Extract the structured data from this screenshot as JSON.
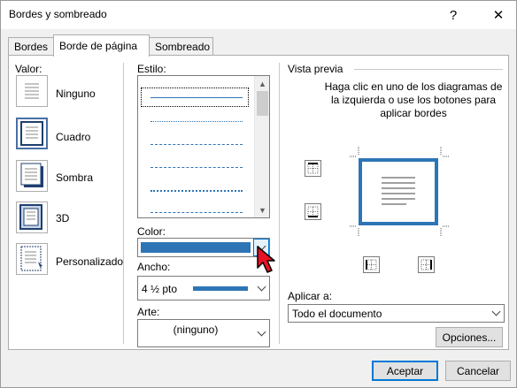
{
  "window": {
    "title": "Bordes y sombreado",
    "help": "?",
    "close": "✕"
  },
  "tabs": [
    {
      "label": "Bordes"
    },
    {
      "label": "Borde de página"
    },
    {
      "label": "Sombreado"
    }
  ],
  "settings": {
    "label": "Valor:",
    "items": [
      {
        "label": "Ninguno"
      },
      {
        "label": "Cuadro"
      },
      {
        "label": "Sombra"
      },
      {
        "label": "3D"
      },
      {
        "label": "Personalizado"
      }
    ]
  },
  "style": {
    "label": "Estilo:"
  },
  "color": {
    "label": "Color:",
    "value": "#2e75b6"
  },
  "width": {
    "label": "Ancho:",
    "value": "4 ½ pto"
  },
  "art": {
    "label": "Arte:",
    "value": "(ninguno)"
  },
  "preview": {
    "label": "Vista previa",
    "instructions": "Haga clic en uno de los diagramas de la izquierda o use los botones para aplicar bordes"
  },
  "apply_to": {
    "label": "Aplicar a:",
    "value": "Todo el documento"
  },
  "buttons": {
    "options": "Opciones...",
    "ok": "Aceptar",
    "cancel": "Cancelar"
  },
  "colors": {
    "accent": "#2e75b6",
    "focus": "#0078d7"
  }
}
